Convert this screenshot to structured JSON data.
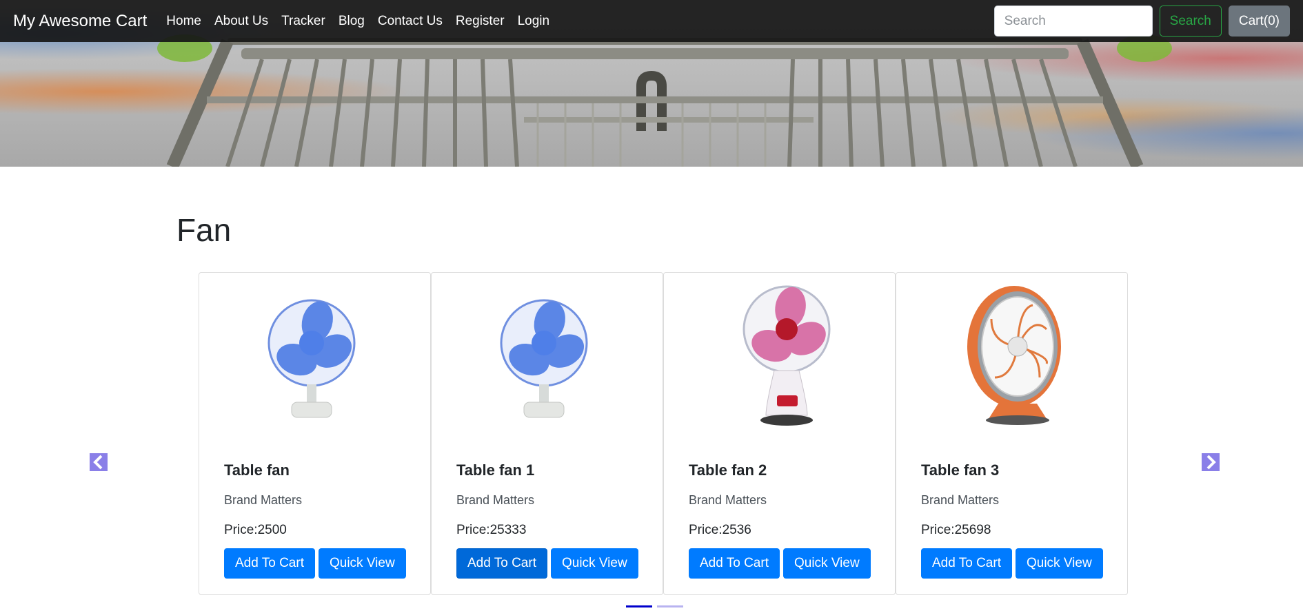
{
  "navbar": {
    "brand": "My Awesome Cart",
    "links": [
      "Home",
      "About Us",
      "Tracker",
      "Blog",
      "Contact Us",
      "Register",
      "Login"
    ],
    "search_placeholder": "Search",
    "search_button": "Search",
    "cart_button": "Cart(0)"
  },
  "section": {
    "title": "Fan"
  },
  "products": [
    {
      "title": "Table fan",
      "brand": "Brand Matters",
      "price": "Price:2500",
      "add_label": "Add To Cart",
      "view_label": "Quick View",
      "icon": "blue-fan-image"
    },
    {
      "title": "Table fan 1",
      "brand": "Brand Matters",
      "price": "Price:25333",
      "add_label": "Add To Cart",
      "view_label": "Quick View",
      "icon": "blue-fan-image"
    },
    {
      "title": "Table fan 2",
      "brand": "Brand Matters",
      "price": "Price:2536",
      "add_label": "Add To Cart",
      "view_label": "Quick View",
      "icon": "pink-fan-image"
    },
    {
      "title": "Table fan 3",
      "brand": "Brand Matters",
      "price": "Price:25698",
      "add_label": "Add To Cart",
      "view_label": "Quick View",
      "icon": "orange-fan-image"
    }
  ],
  "carousel": {
    "prev_icon": "chevron-left-icon",
    "next_icon": "chevron-right-icon",
    "active_slide": 1,
    "slide_count": 2
  },
  "colors": {
    "primary": "#007bff",
    "success": "#28a745",
    "secondary": "#6c757d",
    "nav_bg": "#161616",
    "arrow": "#8a7fe8",
    "indicator_active": "#0000cc",
    "indicator_inactive": "#b8b3f0"
  }
}
